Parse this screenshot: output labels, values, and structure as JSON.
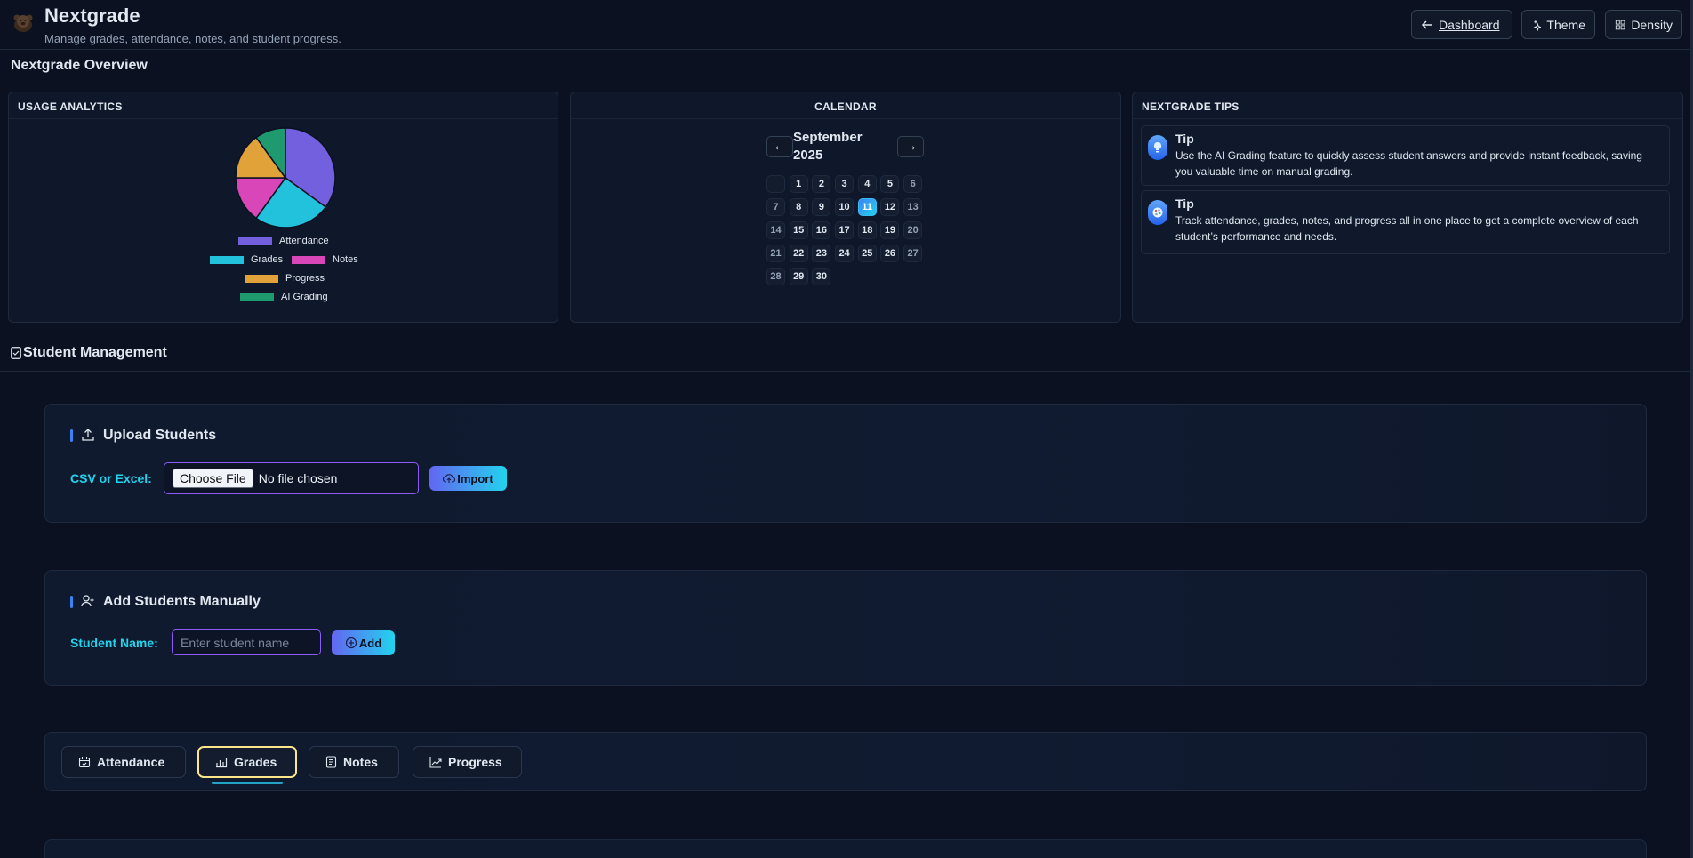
{
  "header": {
    "title": "Nextgrade",
    "subtitle": "Manage grades, attendance, notes, and student progress.",
    "buttons": {
      "dashboard": "Dashboard",
      "theme": "Theme",
      "density": "Density"
    }
  },
  "overview": {
    "title": "Nextgrade Overview",
    "usage": {
      "title": "USAGE ANALYTICS",
      "chart_data": {
        "type": "pie",
        "categories": [
          "Attendance",
          "Grades",
          "Notes",
          "Progress",
          "AI Grading"
        ],
        "values": [
          35,
          25,
          15,
          15,
          10
        ],
        "colors": [
          "#7360de",
          "#22c1dc",
          "#d946b8",
          "#e2a23a",
          "#1e9a6e"
        ],
        "legend": "bottom"
      }
    },
    "calendar": {
      "title": "CALENDAR",
      "month": "September",
      "year": "2025",
      "prev": "←",
      "next": "→",
      "today": 11,
      "leading_blanks": 1,
      "days_in_month": 30
    },
    "tips": {
      "title": "NEXTGRADE TIPS",
      "items": [
        {
          "title": "Tip",
          "text": "Use the AI Grading feature to quickly assess student answers and provide instant feedback, saving you valuable time on manual grading.",
          "icon": "lightbulb-icon"
        },
        {
          "title": "Tip",
          "text": "Track attendance, grades, notes, and progress all in one place to get a complete overview of each student’s performance and needs.",
          "icon": "palette-icon"
        }
      ]
    }
  },
  "student_management": {
    "title": "Student Management",
    "upload": {
      "title": "Upload Students",
      "label": "CSV or Excel:",
      "file_button": "Choose File",
      "file_status": "No file chosen",
      "import_label": "Import"
    },
    "manual": {
      "title": "Add Students Manually",
      "label": "Student Name:",
      "placeholder": "Enter student name",
      "add_label": "Add"
    },
    "tabs": [
      {
        "label": "Attendance",
        "icon": "calendar-check-icon",
        "active": false
      },
      {
        "label": "Grades",
        "icon": "bar-chart-icon",
        "active": true
      },
      {
        "label": "Notes",
        "icon": "document-icon",
        "active": false
      },
      {
        "label": "Progress",
        "icon": "trend-up-icon",
        "active": false
      }
    ]
  }
}
